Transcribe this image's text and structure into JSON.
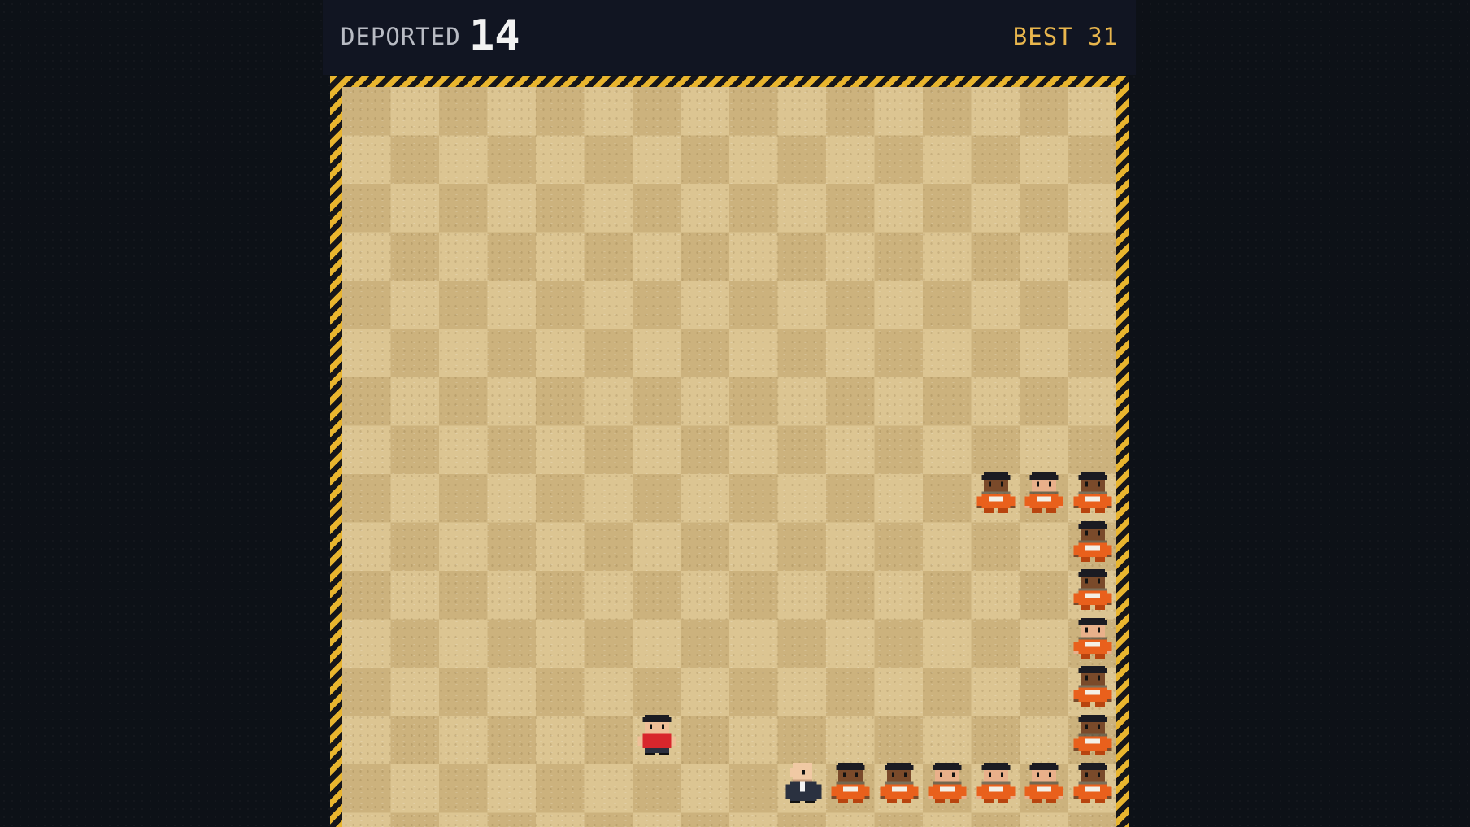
{
  "hud": {
    "deported_label": "DEPORTED",
    "deported_value": "14",
    "best_text": "BEST 31"
  },
  "colors": {
    "hud_background": "#111522",
    "best_color": "#e9b64d",
    "hazard_stripe": "#e9b52e",
    "sand_light": "#dcc592",
    "sand_dark": "#ccb27d",
    "prisoner_jumpsuit": "#e9601c",
    "player_shirt": "#d8262c",
    "agent_suit": "#2a3140"
  },
  "board": {
    "columns": 16,
    "rows": 16
  },
  "player": {
    "sprite": "red-shirt-person-sprite",
    "col": 6,
    "row": 13
  },
  "agent": {
    "sprite": "bald-suited-agent-sprite",
    "col": 9,
    "row": 14
  },
  "line_of_prisoners": [
    {
      "col": 10,
      "row": 14,
      "skin": "dark"
    },
    {
      "col": 11,
      "row": 14,
      "skin": "dark"
    },
    {
      "col": 12,
      "row": 14,
      "skin": "light"
    },
    {
      "col": 13,
      "row": 14,
      "skin": "light"
    },
    {
      "col": 14,
      "row": 14,
      "skin": "light"
    },
    {
      "col": 15,
      "row": 14,
      "skin": "dark"
    },
    {
      "col": 15,
      "row": 13,
      "skin": "dark"
    },
    {
      "col": 15,
      "row": 12,
      "skin": "dark"
    },
    {
      "col": 15,
      "row": 11,
      "skin": "light"
    },
    {
      "col": 15,
      "row": 10,
      "skin": "dark"
    },
    {
      "col": 15,
      "row": 9,
      "skin": "dark"
    },
    {
      "col": 15,
      "row": 8,
      "skin": "dark"
    },
    {
      "col": 14,
      "row": 8,
      "skin": "light"
    },
    {
      "col": 13,
      "row": 8,
      "skin": "dark"
    }
  ]
}
